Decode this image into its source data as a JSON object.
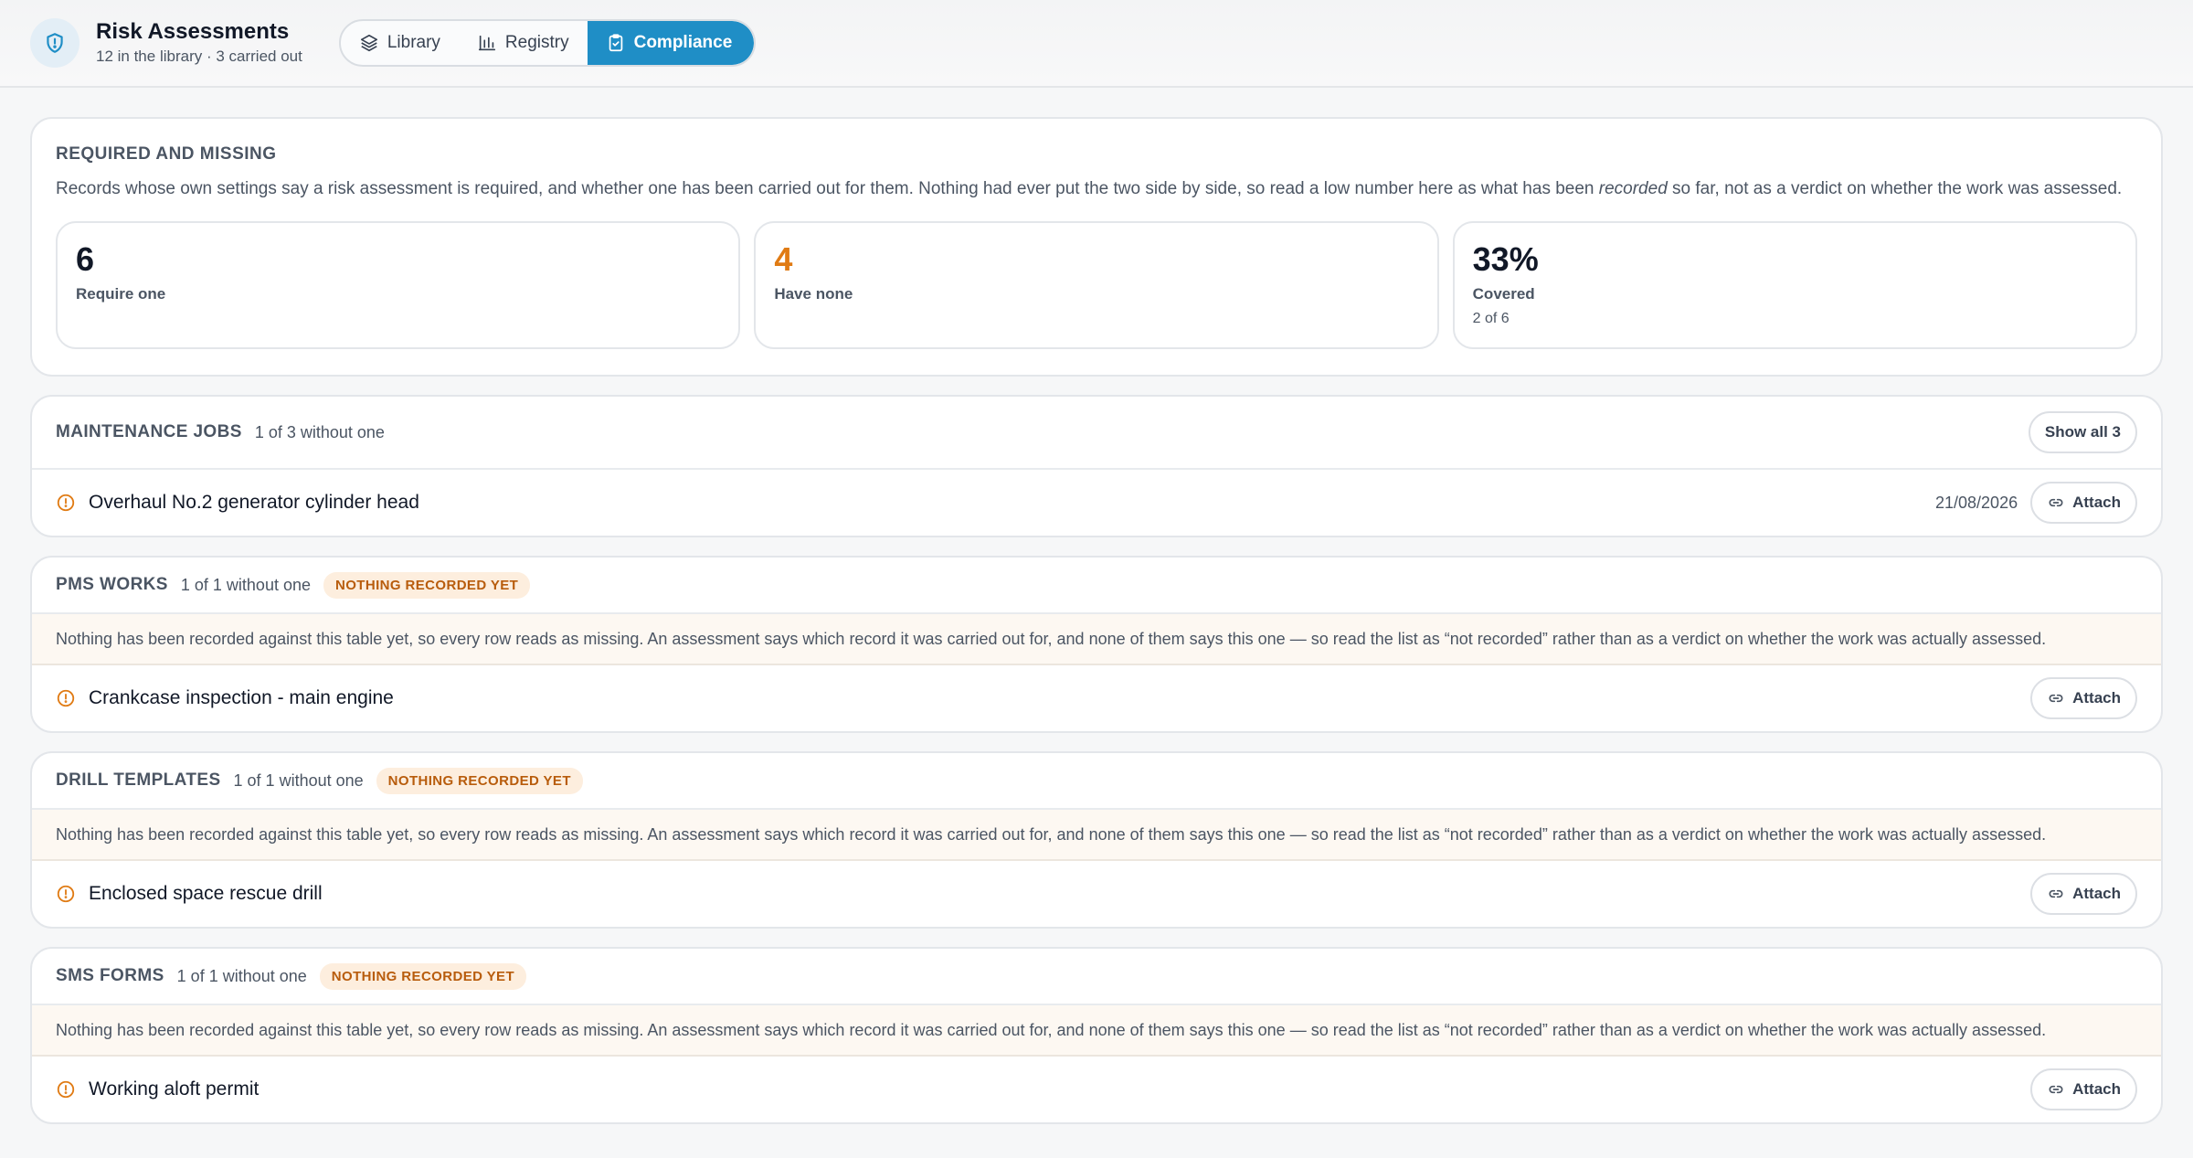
{
  "header": {
    "title": "Risk Assessments",
    "subtitle": "12 in the library · 3 carried out",
    "tabs": [
      {
        "label": "Library",
        "icon": "layers-icon"
      },
      {
        "label": "Registry",
        "icon": "bar-chart-icon"
      },
      {
        "label": "Compliance",
        "icon": "clipboard-check-icon",
        "active": true
      }
    ]
  },
  "summary": {
    "heading": "REQUIRED AND MISSING",
    "desc_before": "Records whose own settings say a risk assessment is required, and whether one has been carried out for them. Nothing had ever put the two side by side, so read a low number here as what has been ",
    "desc_emphasis": "recorded",
    "desc_after": " so far, not as a verdict on whether the work was assessed.",
    "stats": [
      {
        "value": "6",
        "label": "Require one",
        "sub": ""
      },
      {
        "value": "4",
        "label": "Have none",
        "sub": ""
      },
      {
        "value": "33%",
        "label": "Covered",
        "sub": "2 of 6"
      }
    ]
  },
  "groups": [
    {
      "name": "MAINTENANCE JOBS",
      "count": "1 of 3 without one",
      "show_all": "Show all 3",
      "items": [
        {
          "title": "Overhaul No.2 generator cylinder head",
          "date": "21/08/2026",
          "action": "Attach"
        }
      ]
    },
    {
      "name": "PMS WORKS",
      "count": "1 of 1 without one",
      "badge": "NOTHING RECORDED YET",
      "notice": "Nothing has been recorded against this table yet, so every row reads as missing. An assessment says which record it was carried out for, and none of them says this one — so read the list as “not recorded” rather than as a verdict on whether the work was actually assessed.",
      "items": [
        {
          "title": "Crankcase inspection - main engine",
          "action": "Attach"
        }
      ]
    },
    {
      "name": "DRILL TEMPLATES",
      "count": "1 of 1 without one",
      "badge": "NOTHING RECORDED YET",
      "notice": "Nothing has been recorded against this table yet, so every row reads as missing. An assessment says which record it was carried out for, and none of them says this one — so read the list as “not recorded” rather than as a verdict on whether the work was actually assessed.",
      "items": [
        {
          "title": "Enclosed space rescue drill",
          "action": "Attach"
        }
      ]
    },
    {
      "name": "SMS FORMS",
      "count": "1 of 1 without one",
      "badge": "NOTHING RECORDED YET",
      "notice": "Nothing has been recorded against this table yet, so every row reads as missing. An assessment says which record it was carried out for, and none of them says this one — so read the list as “not recorded” rather than as a verdict on whether the work was actually assessed.",
      "items": [
        {
          "title": "Working aloft permit",
          "action": "Attach"
        }
      ]
    }
  ],
  "colors": {
    "accent": "#1f8ec6",
    "warning": "#e07b14",
    "badge_bg": "#fdeede",
    "badge_text": "#b85c0c"
  }
}
